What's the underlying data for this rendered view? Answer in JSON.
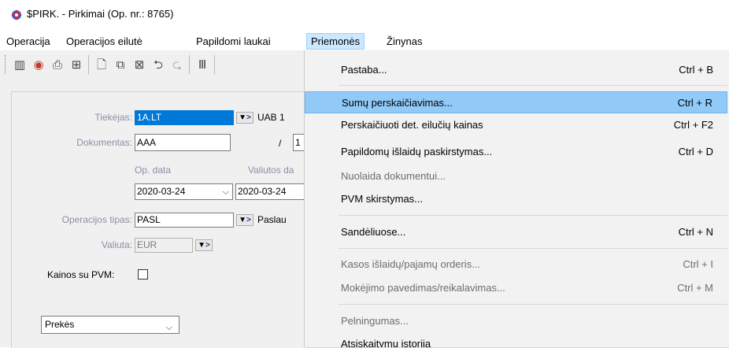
{
  "window": {
    "title": "$PIRK. - Pirkimai (Op. nr.: 8765)"
  },
  "menubar": {
    "items": [
      {
        "label": "Operacija"
      },
      {
        "label": "Operacijos eilutė"
      },
      {
        "label": "Papildomi laukai"
      },
      {
        "label": "Priemonės"
      },
      {
        "label": "Žinynas"
      }
    ]
  },
  "form": {
    "tiekejas_label": "Tiekėjas:",
    "tiekejas_value": "1A.LT",
    "tiekejas_name": "UAB 1",
    "dokumentas_label": "Dokumentas:",
    "dokumentas_value": "AAA",
    "dokumentas_sep": "/",
    "dokumentas_nr": "1",
    "op_data_label": "Op. data",
    "valiutos_data_label": "Valiutos da",
    "op_data_value": "2020-03-24",
    "valiutos_data_value": "2020-03-24",
    "op_tipas_label": "Operacijos tipas:",
    "op_tipas_value": "PASL",
    "op_tipas_name": "Paslau",
    "valiuta_label": "Valiuta:",
    "valiuta_value": "EUR",
    "kainos_label": "Kainos su PVM:",
    "prekes_value": "Prekės",
    "lookup_glyph": "▼",
    "lookup_arrow": ">"
  },
  "dropdown": {
    "items": [
      {
        "label": "Pastaba...",
        "shortcut": "Ctrl + B",
        "enabled": true
      },
      {
        "label": "Sumų perskaičiavimas...",
        "shortcut": "Ctrl + R",
        "enabled": true,
        "highlighted": true
      },
      {
        "label": "Perskaičiuoti det. eilučių kainas",
        "shortcut": "Ctrl + F2",
        "enabled": true
      },
      {
        "label": "Papildomų išlaidų paskirstymas...",
        "shortcut": "Ctrl + D",
        "enabled": true
      },
      {
        "label": "Nuolaida dokumentui...",
        "shortcut": "",
        "enabled": false
      },
      {
        "label": "PVM skirstymas...",
        "shortcut": "",
        "enabled": true
      },
      {
        "label": "Sandėliuose...",
        "shortcut": "Ctrl + N",
        "enabled": true
      },
      {
        "label": "Kasos išlaidų/pajamų orderis...",
        "shortcut": "Ctrl + I",
        "enabled": false
      },
      {
        "label": "Mokėjimo pavedimas/reikalavimas...",
        "shortcut": "Ctrl + M",
        "enabled": false
      },
      {
        "label": "Pelningumas...",
        "shortcut": "",
        "enabled": false
      },
      {
        "label": "Atsiskaitymų istorija",
        "shortcut": "",
        "enabled": true
      }
    ]
  },
  "colors": {
    "highlight": "#91c9f7",
    "menu_active": "#cce8ff",
    "selection": "#0078d7"
  }
}
